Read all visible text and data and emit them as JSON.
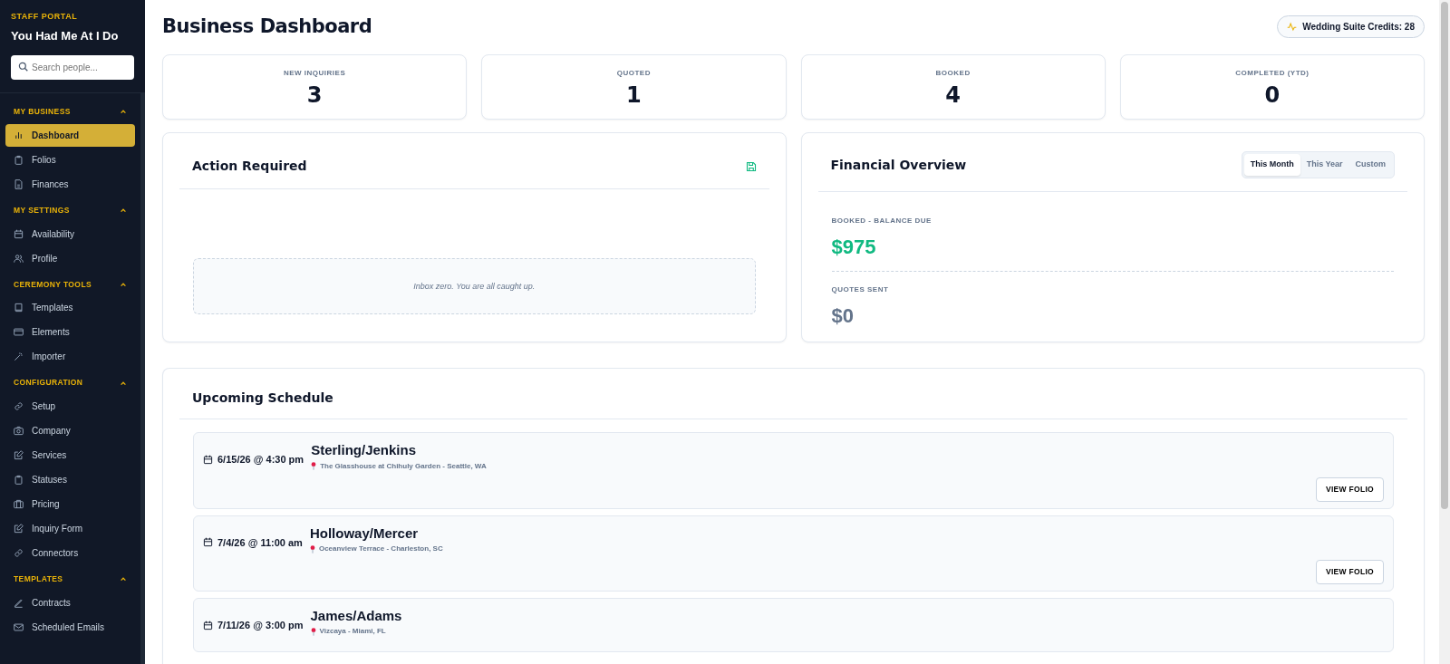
{
  "sidebar": {
    "eyebrow": "STAFF PORTAL",
    "brand": "You Had Me At I Do",
    "search": {
      "placeholder": "Search people..."
    },
    "sections": [
      {
        "title": "MY BUSINESS",
        "expanded": true,
        "items": [
          {
            "label": "Dashboard",
            "selected": true
          },
          {
            "label": "Folios",
            "selected": false
          },
          {
            "label": "Finances",
            "selected": false
          }
        ]
      },
      {
        "title": "MY SETTINGS",
        "expanded": true,
        "items": [
          {
            "label": "Availability",
            "selected": false
          },
          {
            "label": "Profile",
            "selected": false
          }
        ]
      },
      {
        "title": "CEREMONY TOOLS",
        "expanded": true,
        "items": [
          {
            "label": "Templates",
            "selected": false
          },
          {
            "label": "Elements",
            "selected": false
          },
          {
            "label": "Importer",
            "selected": false
          }
        ]
      },
      {
        "title": "CONFIGURATION",
        "expanded": true,
        "items": [
          {
            "label": "Setup",
            "selected": false
          },
          {
            "label": "Company",
            "selected": false
          },
          {
            "label": "Services",
            "selected": false
          },
          {
            "label": "Statuses",
            "selected": false
          },
          {
            "label": "Pricing",
            "selected": false
          },
          {
            "label": "Inquiry Form",
            "selected": false
          },
          {
            "label": "Connectors",
            "selected": false
          }
        ]
      },
      {
        "title": "TEMPLATES",
        "expanded": true,
        "items": [
          {
            "label": "Contracts",
            "selected": false
          },
          {
            "label": "Scheduled Emails",
            "selected": false
          }
        ]
      }
    ]
  },
  "page": {
    "title": "Business Dashboard",
    "credits": "Wedding Suite Credits: 28"
  },
  "stats": [
    {
      "label": "NEW INQUIRIES",
      "value": "3"
    },
    {
      "label": "QUOTED",
      "value": "1"
    },
    {
      "label": "BOOKED",
      "value": "4"
    },
    {
      "label": "COMPLETED (YTD)",
      "value": "0"
    }
  ],
  "action_required": {
    "title": "Action Required",
    "empty_message": "Inbox zero. You are all caught up."
  },
  "financial_overview": {
    "title": "Financial Overview",
    "periods": [
      {
        "label": "This Month",
        "selected": true
      },
      {
        "label": "This Year",
        "selected": false
      },
      {
        "label": "Custom",
        "selected": false
      }
    ],
    "metrics": [
      {
        "label": "BOOKED - BALANCE DUE",
        "value": "$975",
        "color": "#10b981"
      },
      {
        "label": "QUOTES SENT",
        "value": "$0",
        "color": "#64748b"
      }
    ]
  },
  "schedule": {
    "title": "Upcoming Schedule",
    "events": [
      {
        "date": "6/15/26 @ 4:30 pm",
        "couple": "Sterling/Jenkins",
        "location": "The Glasshouse at Chihuly Garden - Seattle, WA",
        "button": "VIEW FOLIO"
      },
      {
        "date": "7/4/26 @ 11:00 am",
        "couple": "Holloway/Mercer",
        "location": "Oceanview Terrace - Charleston, SC",
        "button": "VIEW FOLIO"
      },
      {
        "date": "7/11/26 @ 3:00 pm",
        "couple": "James/Adams",
        "location": "Vizcaya - Miami, FL"
      }
    ]
  }
}
